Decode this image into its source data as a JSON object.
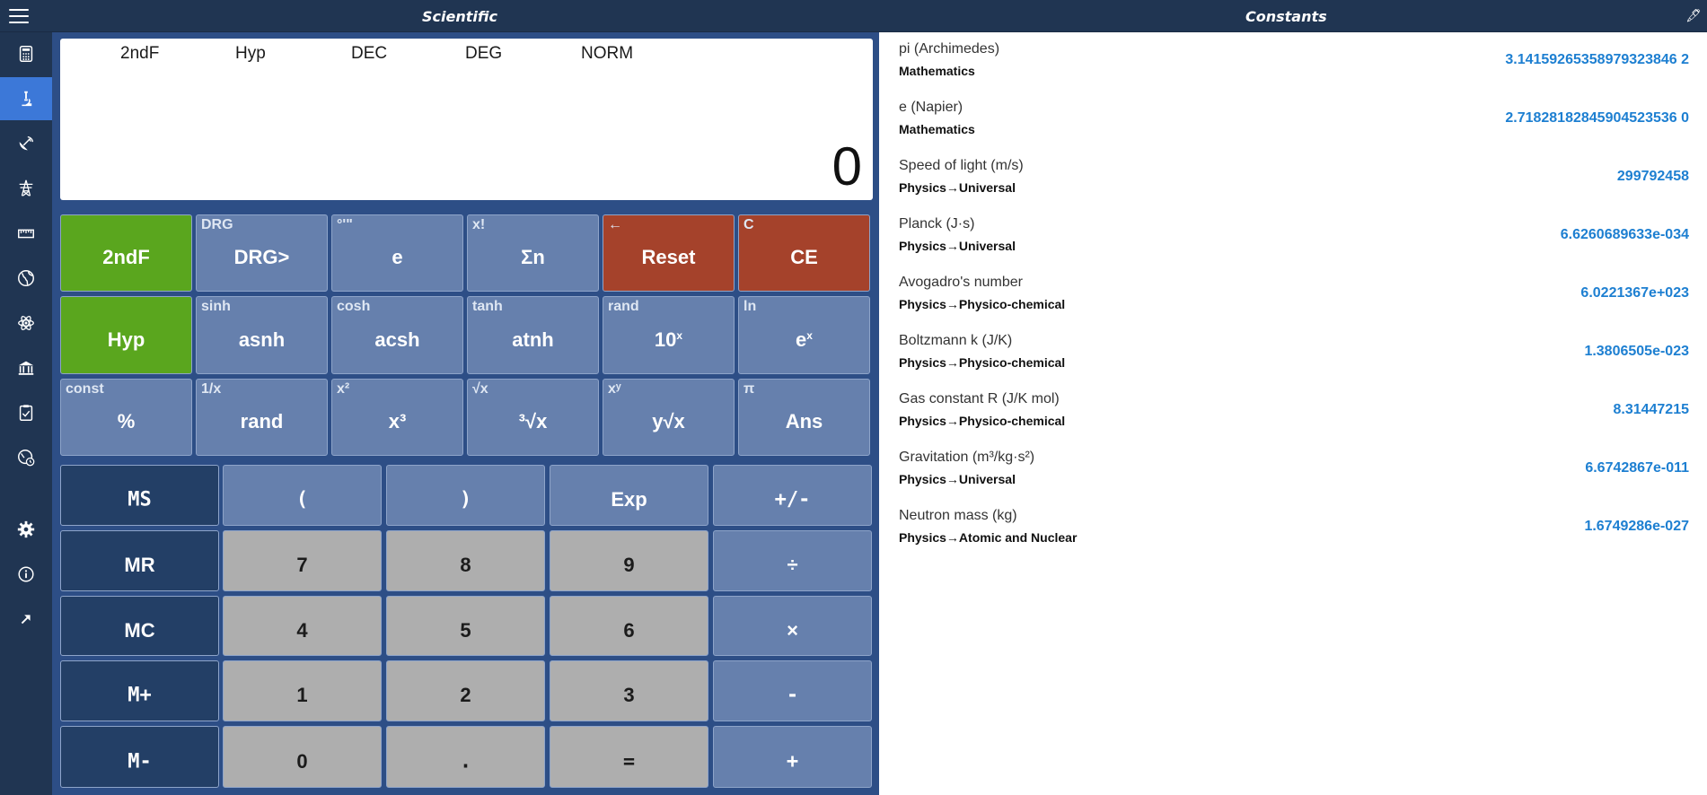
{
  "header": {
    "left_title": "Scientific",
    "right_title": "Constants"
  },
  "sidebar": {
    "items": [
      {
        "icon": "calculator-icon"
      },
      {
        "icon": "microscope-icon",
        "active": true
      },
      {
        "icon": "satellite-dish-icon"
      },
      {
        "icon": "power-tower-icon"
      },
      {
        "icon": "ruler-icon"
      },
      {
        "icon": "globe-icon"
      },
      {
        "icon": "atom-icon"
      },
      {
        "icon": "bank-icon"
      },
      {
        "icon": "clipboard-icon"
      },
      {
        "icon": "globe-clock-icon"
      },
      {
        "icon": "gear-icon"
      },
      {
        "icon": "info-icon"
      },
      {
        "icon": "expand-arrow-icon"
      }
    ]
  },
  "display": {
    "modes": [
      "2ndF",
      "Hyp",
      "DEC",
      "DEG",
      "NORM"
    ],
    "value": "0"
  },
  "keys": {
    "row1": [
      {
        "main": "2ndF",
        "sub": ""
      },
      {
        "main": "DRG>",
        "sub": "DRG"
      },
      {
        "main": "e",
        "sub": "°'\""
      },
      {
        "main": "Σn",
        "sub": "x!"
      },
      {
        "main": "Reset",
        "sub": "←"
      },
      {
        "main": "CE",
        "sub": "C"
      }
    ],
    "row2": [
      {
        "main": "Hyp",
        "sub": ""
      },
      {
        "main": "asnh",
        "sub": "sinh"
      },
      {
        "main": "acsh",
        "sub": "cosh"
      },
      {
        "main": "atnh",
        "sub": "tanh"
      },
      {
        "main": "10",
        "sup": "x",
        "sub": "rand"
      },
      {
        "main": "e",
        "sup": "x",
        "sub": "ln"
      }
    ],
    "row3": [
      {
        "main": "%",
        "sub": "const"
      },
      {
        "main": "rand",
        "sub": "1/x"
      },
      {
        "main": "x³",
        "sub": "x²"
      },
      {
        "main": "³√x",
        "sub": "√x"
      },
      {
        "main": "y√x",
        "sub": "xʸ"
      },
      {
        "main": "Ans",
        "sub": "π"
      }
    ],
    "grid": [
      [
        "MS",
        "(",
        ")",
        "Exp",
        "+/-"
      ],
      [
        "MR",
        "7",
        "8",
        "9",
        "÷"
      ],
      [
        "MC",
        "4",
        "5",
        "6",
        "×"
      ],
      [
        "M+",
        "1",
        "2",
        "3",
        "-"
      ],
      [
        "M-",
        "0",
        ".",
        "=",
        "+"
      ]
    ]
  },
  "constants": [
    {
      "name": "pi (Archimedes)",
      "category": "Mathematics",
      "value": "3.14159265358979323846 2"
    },
    {
      "name": "e (Napier)",
      "category": "Mathematics",
      "value": "2.71828182845904523536 0"
    },
    {
      "name": "Speed of light (m/s)",
      "category": "Physics→Universal",
      "value": "299792458"
    },
    {
      "name": "Planck (J·s)",
      "category": "Physics→Universal",
      "value": "6.6260689633e-034"
    },
    {
      "name": "Avogadro's number",
      "category": "Physics→Physico-chemical",
      "value": "6.0221367e+023"
    },
    {
      "name": "Boltzmann k (J/K)",
      "category": "Physics→Physico-chemical",
      "value": "1.3806505e-023"
    },
    {
      "name": "Gas constant R (J/K mol)",
      "category": "Physics→Physico-chemical",
      "value": "8.31447215"
    },
    {
      "name": "Gravitation (m³/kg·s²)",
      "category": "Physics→Universal",
      "value": "6.6742867e-011"
    },
    {
      "name": "Neutron mass (kg)",
      "category": "Physics→Atomic and Nuclear",
      "value": "1.6749286e-027"
    }
  ]
}
